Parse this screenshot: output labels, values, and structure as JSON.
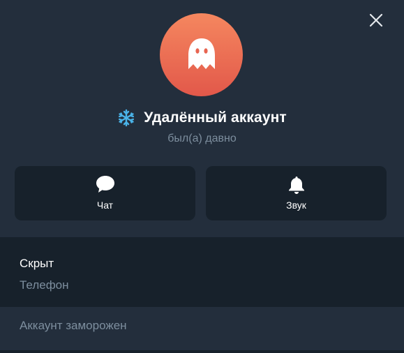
{
  "profile": {
    "name": "Удалённый аккаунт",
    "status": "был(а) давно",
    "status_icon": "snowflake-icon",
    "avatar_icon": "ghost-icon",
    "avatar_color": "#ef6f55"
  },
  "actions": {
    "chat": {
      "label": "Чат",
      "icon": "chat-bubble-icon"
    },
    "sound": {
      "label": "Звук",
      "icon": "bell-icon"
    }
  },
  "info": {
    "phone_value": "Скрыт",
    "phone_label": "Телефон"
  },
  "footer": {
    "frozen_note": "Аккаунт заморожен"
  },
  "colors": {
    "panel_bg": "#232e3c",
    "section_bg": "#17212b",
    "muted_text": "#7d8e9e",
    "snowflake": "#4ab3e8"
  }
}
